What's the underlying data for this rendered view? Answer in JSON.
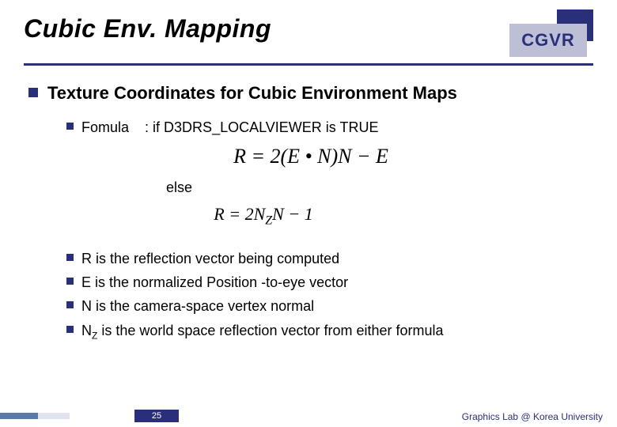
{
  "header": {
    "title": "Cubic Env. Mapping",
    "badge": "CGVR"
  },
  "main": {
    "heading": "Texture Coordinates for Cubic Environment Maps",
    "formula_label": "Fomula",
    "condition_true": ": if D3DRS_LOCALVIEWER is TRUE",
    "formula_true": "R = 2(E • N)N − E",
    "else_label": "else",
    "formula_false_prefix": "R = 2N",
    "formula_false_sub": "Z",
    "formula_false_suffix": "N − 1",
    "definitions": [
      "R is the reflection vector being computed",
      "E is the normalized Position -to-eye vector",
      "N is the camera-space vertex normal"
    ],
    "def_nz_prefix": "N",
    "def_nz_sub": "Z",
    "def_nz_rest": " is the world space reflection vector from either formula"
  },
  "footer": {
    "page": "25",
    "credit": "Graphics Lab @ Korea University"
  }
}
